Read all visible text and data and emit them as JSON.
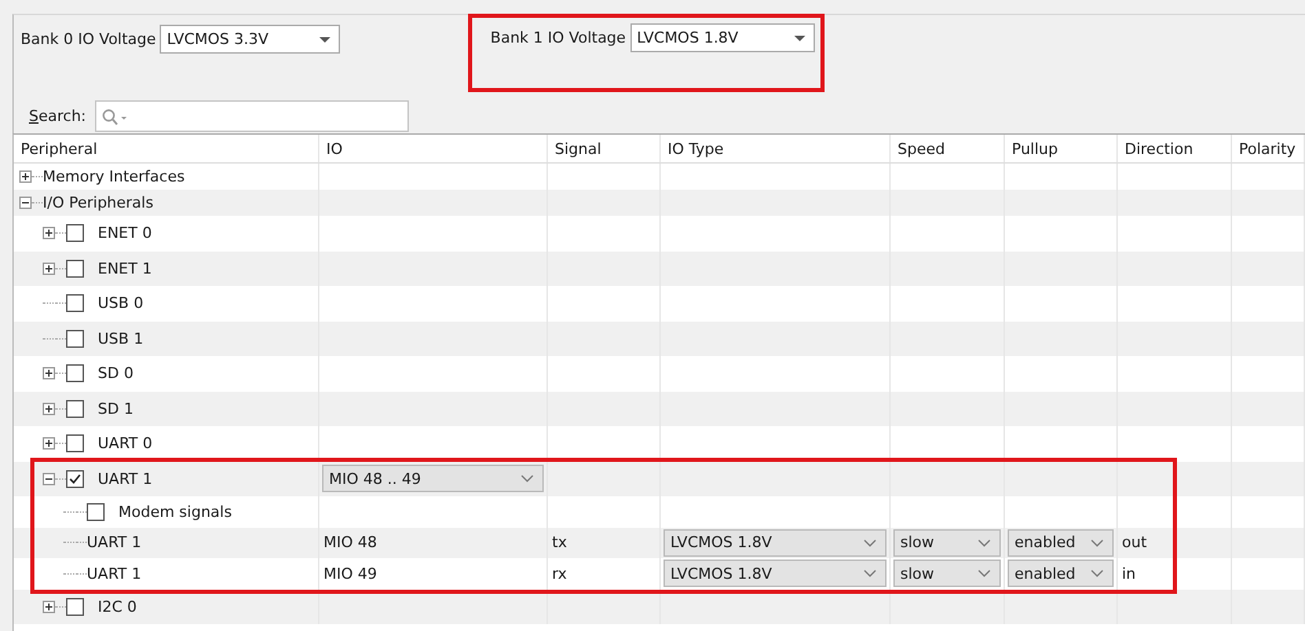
{
  "bank_0": {
    "label": "Bank 0 IO Voltage",
    "value": "LVCMOS 3.3V",
    "highlighted": false
  },
  "bank_1": {
    "label": "Bank 1 IO Voltage",
    "value": "LVCMOS 1.8V",
    "highlighted": true
  },
  "search": {
    "label": "Search:"
  },
  "table": {
    "columns": [
      "Peripheral",
      "IO",
      "Signal",
      "IO Type",
      "Speed",
      "Pullup",
      "Direction",
      "Polarity"
    ],
    "tree": [
      {
        "kind": "group",
        "label": "Memory Interfaces",
        "expanded": false
      },
      {
        "kind": "group",
        "label": "I/O Peripherals",
        "expanded": true,
        "children": [
          {
            "kind": "peripheral",
            "label": "ENET 0",
            "checked": false,
            "expanded": false
          },
          {
            "kind": "peripheral",
            "label": "ENET 1",
            "checked": false,
            "expanded": false
          },
          {
            "kind": "peripheral",
            "label": "USB 0",
            "checked": false
          },
          {
            "kind": "peripheral",
            "label": "USB 1",
            "checked": false
          },
          {
            "kind": "peripheral",
            "label": "SD 0",
            "checked": false,
            "expanded": false
          },
          {
            "kind": "peripheral",
            "label": "SD 1",
            "checked": false,
            "expanded": false
          },
          {
            "kind": "peripheral",
            "label": "UART 0",
            "checked": false,
            "expanded": false
          },
          {
            "kind": "peripheral",
            "label": "UART 1",
            "checked": true,
            "expanded": true,
            "highlighted": true,
            "io": "MIO 48 .. 49",
            "children": [
              {
                "kind": "option",
                "label": "Modem signals",
                "checked": false
              },
              {
                "kind": "signal",
                "label": "UART 1",
                "io": "MIO 48",
                "signal": "tx",
                "io_type": "LVCMOS 1.8V",
                "speed": "slow",
                "pullup": "enabled",
                "direction": "out"
              },
              {
                "kind": "signal",
                "label": "UART 1",
                "io": "MIO 49",
                "signal": "rx",
                "io_type": "LVCMOS 1.8V",
                "speed": "slow",
                "pullup": "enabled",
                "direction": "in"
              }
            ]
          },
          {
            "kind": "peripheral",
            "label": "I2C 0",
            "checked": false,
            "expanded": false
          }
        ]
      }
    ]
  }
}
